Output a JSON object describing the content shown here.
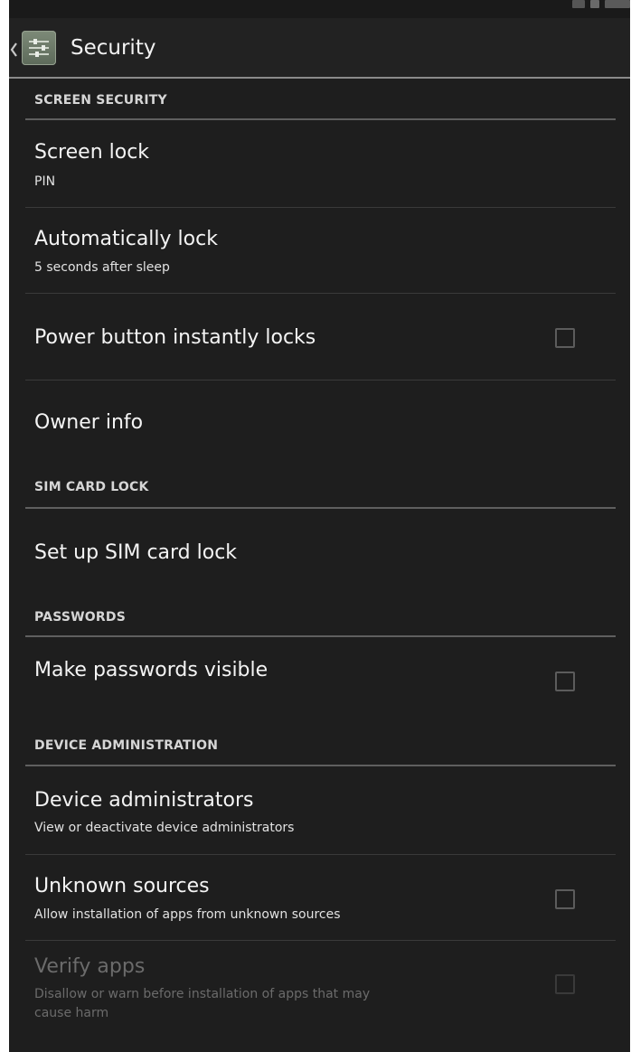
{
  "window": {
    "title": "Security"
  },
  "sections": [
    {
      "header": "SCREEN SECURITY",
      "items": [
        {
          "title": "Screen lock",
          "summary": "PIN"
        },
        {
          "title": "Automatically lock",
          "summary": "5 seconds after sleep"
        },
        {
          "title": "Power button instantly locks",
          "checked": false
        },
        {
          "title": "Owner info"
        }
      ]
    },
    {
      "header": "SIM CARD LOCK",
      "items": [
        {
          "title": "Set up SIM card lock"
        }
      ]
    },
    {
      "header": "PASSWORDS",
      "items": [
        {
          "title": "Make passwords visible",
          "checked": false
        }
      ]
    },
    {
      "header": "DEVICE ADMINISTRATION",
      "items": [
        {
          "title": "Device administrators",
          "summary": "View or deactivate device administrators"
        },
        {
          "title": "Unknown sources",
          "summary": "Allow installation of apps from unknown sources",
          "checked": false
        },
        {
          "title": "Verify apps",
          "summary": "Disallow or warn before installation of apps that may",
          "summary_line2": "cause harm",
          "checked": false,
          "enabled": false
        }
      ]
    }
  ],
  "icons": {
    "back": "chevron-left-icon",
    "app": "settings-app-icon"
  },
  "colors": {
    "background": "#1e1e1e",
    "text_primary": "#f4f4f4",
    "text_disabled": "#6b6b6b",
    "divider": "#5f5f5f"
  }
}
